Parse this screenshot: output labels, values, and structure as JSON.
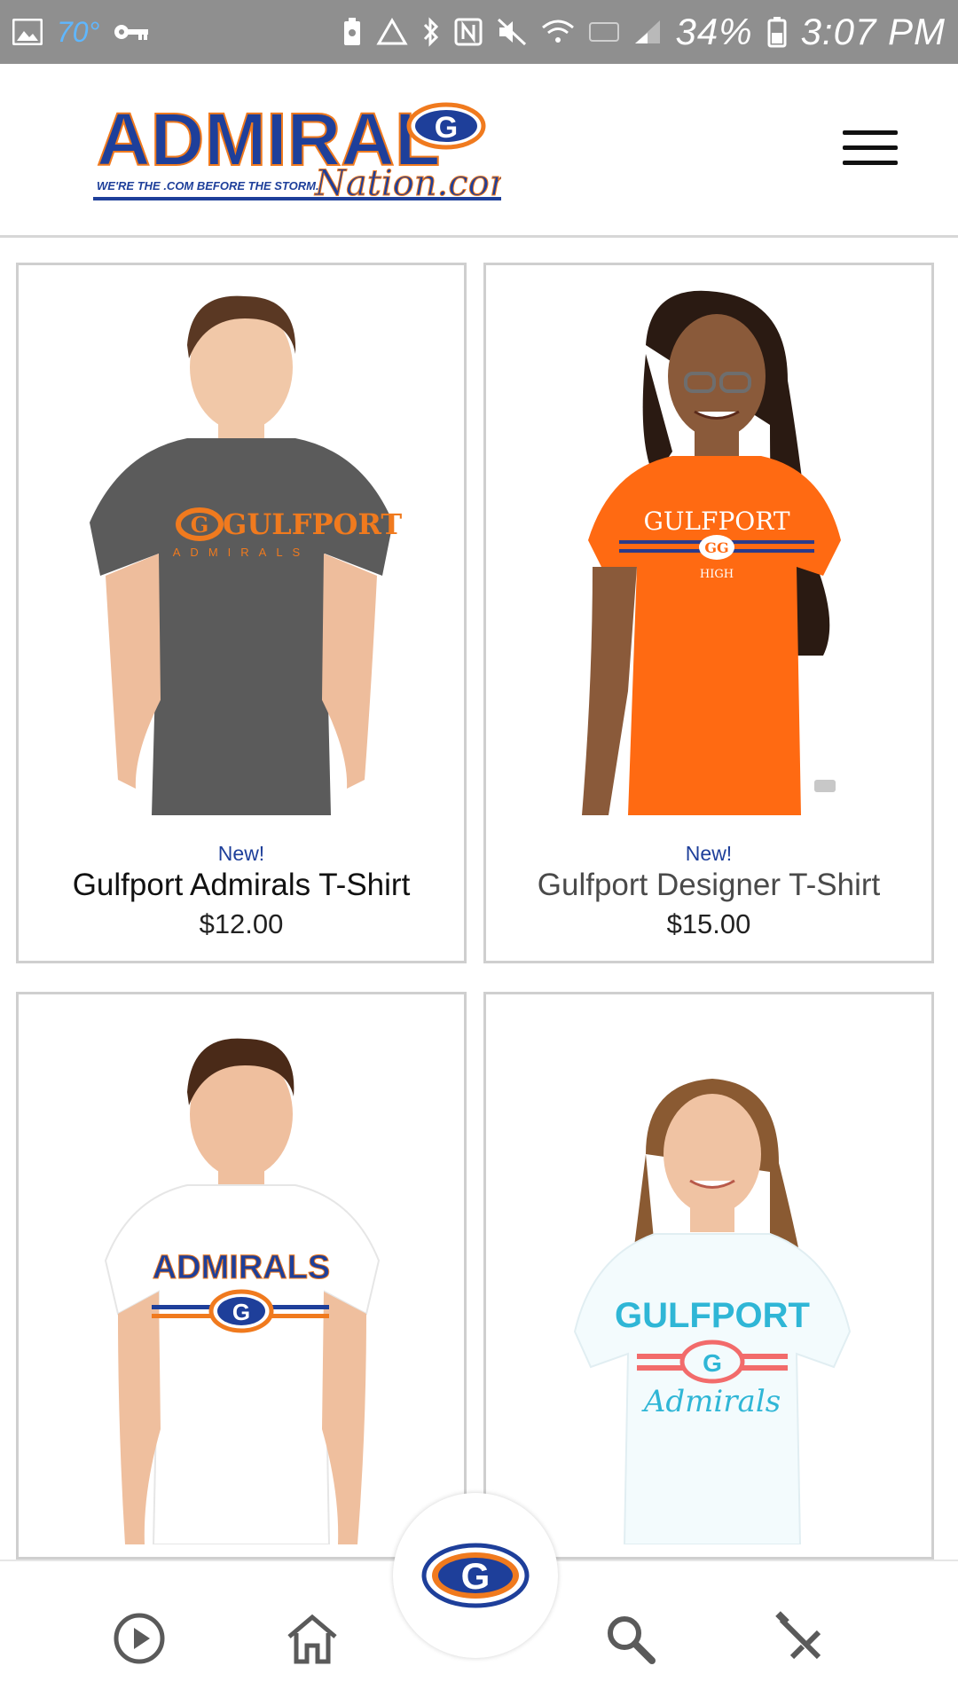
{
  "status_bar": {
    "temperature": "70°",
    "battery_percent": "34%",
    "time": "3:07 PM",
    "icons": [
      "image-icon",
      "key-icon",
      "battery-saver-icon",
      "recycle-icon",
      "bluetooth-icon",
      "nfc-icon",
      "mute-icon",
      "wifi-icon",
      "volte-icon",
      "signal-icon",
      "battery-icon"
    ]
  },
  "header": {
    "logo": {
      "main": "ADMIRAL",
      "script": "Nation.com",
      "tagline": "WE'RE THE .COM BEFORE THE STORM."
    },
    "menu_icon": "hamburger-menu-icon"
  },
  "products": [
    {
      "badge": "New!",
      "name": "Gulfport Admirals T-Shirt",
      "price": "$12.00",
      "shirt_color": "#5b5b5b",
      "print": "GULFPORT",
      "print_sub": "ADMIRALS"
    },
    {
      "badge": "New!",
      "name": "Gulfport Designer T-Shirt",
      "price": "$15.00",
      "shirt_color": "#ff6a12",
      "print": "GULFPORT",
      "print_sub": "HIGH"
    },
    {
      "badge": "",
      "name": "",
      "price": "",
      "shirt_color": "#ffffff",
      "print": "ADMIRALS",
      "print_sub": ""
    },
    {
      "badge": "",
      "name": "",
      "price": "",
      "shirt_color": "#f3fbfd",
      "print": "GULFPORT",
      "print_sub": "Admirals"
    }
  ],
  "bottom_nav": {
    "items": [
      "play-circle-icon",
      "home-icon",
      "g-logo-icon",
      "search-icon",
      "tools-icon"
    ]
  },
  "colors": {
    "brand_blue": "#1e3f9a",
    "brand_orange": "#f07a1e",
    "card_border": "#cfcfcf"
  }
}
